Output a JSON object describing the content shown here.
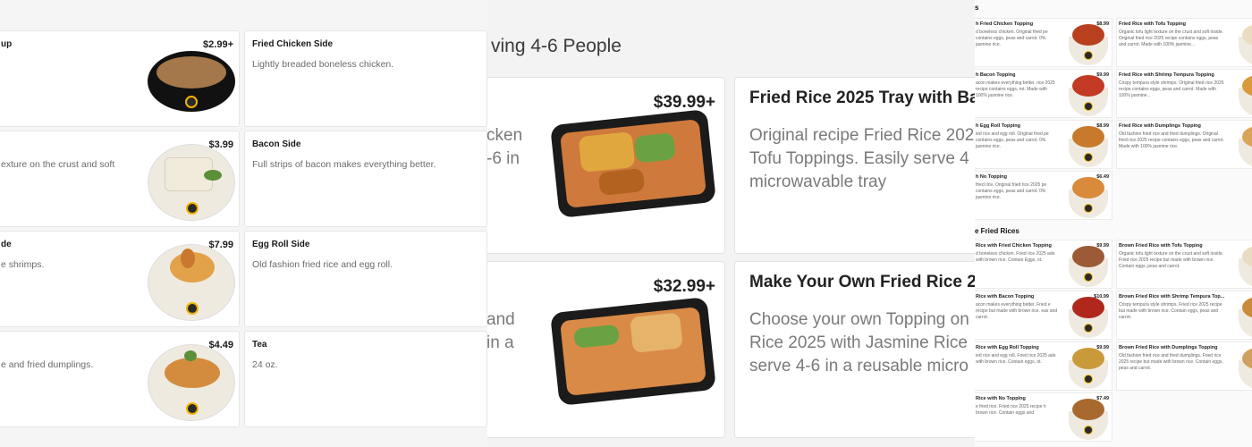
{
  "panel1": {
    "cards": [
      {
        "name": "up",
        "desc": "",
        "price": "$2.99+"
      },
      {
        "name": "Fried Chicken Side",
        "desc": "Lightly breaded boneless chicken.",
        "price": ""
      },
      {
        "name": "",
        "desc": "exture on the crust and soft",
        "price": "$3.99"
      },
      {
        "name": "Bacon Side",
        "desc": "Full strips of bacon makes everything better.",
        "price": ""
      },
      {
        "name": "de",
        "desc": "e shrimps.",
        "price": "$7.99"
      },
      {
        "name": "Egg Roll Side",
        "desc": "Old fashion fried rice and egg roll.",
        "price": ""
      },
      {
        "name": "",
        "desc": "e and fried dumplings.",
        "price": "$4.49"
      },
      {
        "name": "Tea",
        "desc": "24 oz.",
        "price": ""
      }
    ]
  },
  "panel2": {
    "section_title": "ving 4-6 People",
    "cut_text_1": [
      "cken",
      "-6 in"
    ],
    "cut_text_2": [
      "and",
      "in a"
    ],
    "cards": [
      {
        "price": "$39.99+",
        "name": "Fried Rice 2025 Tray with Ba",
        "desc": [
          "Original recipe Fried Rice 202",
          "Tofu Toppings. Easily serve 4",
          "microwavable tray"
        ]
      },
      {
        "price": "$32.99+",
        "name": "Make Your Own Fried Rice 2",
        "desc": [
          "Choose your own Topping on",
          "Rice 2025 with Jasmine Rice",
          "serve 4-6 in a reusable micro"
        ]
      }
    ]
  },
  "panel3": {
    "top_label": "s",
    "section_label": "e Fried Rices",
    "cards": [
      {
        "name": "h Fried Chicken Topping",
        "desc": "d boneless chicken. Original fried pe contains eggs, peas and carrot. 0% jasmine rice.",
        "price": "$8.99",
        "food": "#b8401f"
      },
      {
        "name": "Fried Rice with Tofu Topping",
        "desc": "Organic tofu light texture on the crust and soft inside. Original fried rice 2025 recipe contains eggs, peas and carrot. Made with 100% jasmine...",
        "price": "",
        "food": "#e9dcc0"
      },
      {
        "name": "h Bacon Topping",
        "desc": "acon makes everything better. rice 2025 recipe contains eggs, rot. Made with 100% jasmine rice.",
        "price": "$9.99",
        "food": "#c23a24"
      },
      {
        "name": "Fried Rice with Shrimp Tempura Topping",
        "desc": "Crispy tempura style shrimps. Original fried rice 2025 recipe contains eggs, peas and carrot. Made with 100% jasmine...",
        "price": "",
        "food": "#d99a3c"
      },
      {
        "name": "h Egg Roll Topping",
        "desc": "ied rice and egg roll. Original fried pe contains eggs, peas and carrot. 0% jasmine rice.",
        "price": "$8.99",
        "food": "#c8792c"
      },
      {
        "name": "Fried Rice with Dumplings Topping",
        "desc": "Old fashion fried rice and fried dumplings. Original fried rice 2025 recipe contains eggs, peas and carrot. Made with 100% jasmine rice.",
        "price": "",
        "food": "#d9a45a"
      },
      {
        "name": "h No Topping",
        "desc": "fried rice. Original fried rice 2025 pe contains eggs, peas and carrot. 0% jasmine rice.",
        "price": "$6.49",
        "food": "#d98a3a"
      },
      {
        "name": "Rice with Fried Chicken Topping",
        "desc": "d boneless chicken. Fried rice 2025 ade with brown rice. Contain Eggs, ot.",
        "price": "$9.99",
        "food": "#9c5a36"
      },
      {
        "name": "Brown Fried Rice with Tofu Topping",
        "desc": "Organic tofu light texture on the crust and soft inside. Fried rice 2025 recipe but made with brown rice. Contain eggs, peas and carrot.",
        "price": "",
        "food": "#e8dcc2"
      },
      {
        "name": "Rice with Bacon Topping",
        "desc": "acon makes everything better. Fried e recipe but made with brown rice. eas and carrot.",
        "price": "$10.99",
        "food": "#b0281c"
      },
      {
        "name": "Brown Fried Rice with Shrimp Tempura Top...",
        "desc": "Crispy tempura style shrimps. Fried rice 2025 recipe but made with brown rice. Contain eggs, peas and carrot.",
        "price": "",
        "food": "#c98a3a"
      },
      {
        "name": "Rice with Egg Roll Topping",
        "desc": "ied rice and egg roll. Fried rice 2025 ade with brown rice. Contain eggs, ot.",
        "price": "$9.99",
        "food": "#c89a3a"
      },
      {
        "name": "Brown Fried Rice with Dumplings Topping",
        "desc": "Old fashion fried rice and fried dumplings. Fried rice 2025 recipe but made with brown rice. Contain eggs, peas and carrot.",
        "price": "",
        "food": "#cfa060"
      },
      {
        "name": "Rice with No Topping",
        "desc": "e fried rice. Fried rice 2025 recipe h brown rice. Contain eggs and",
        "price": "$7.49",
        "food": "#a8692e"
      }
    ]
  }
}
